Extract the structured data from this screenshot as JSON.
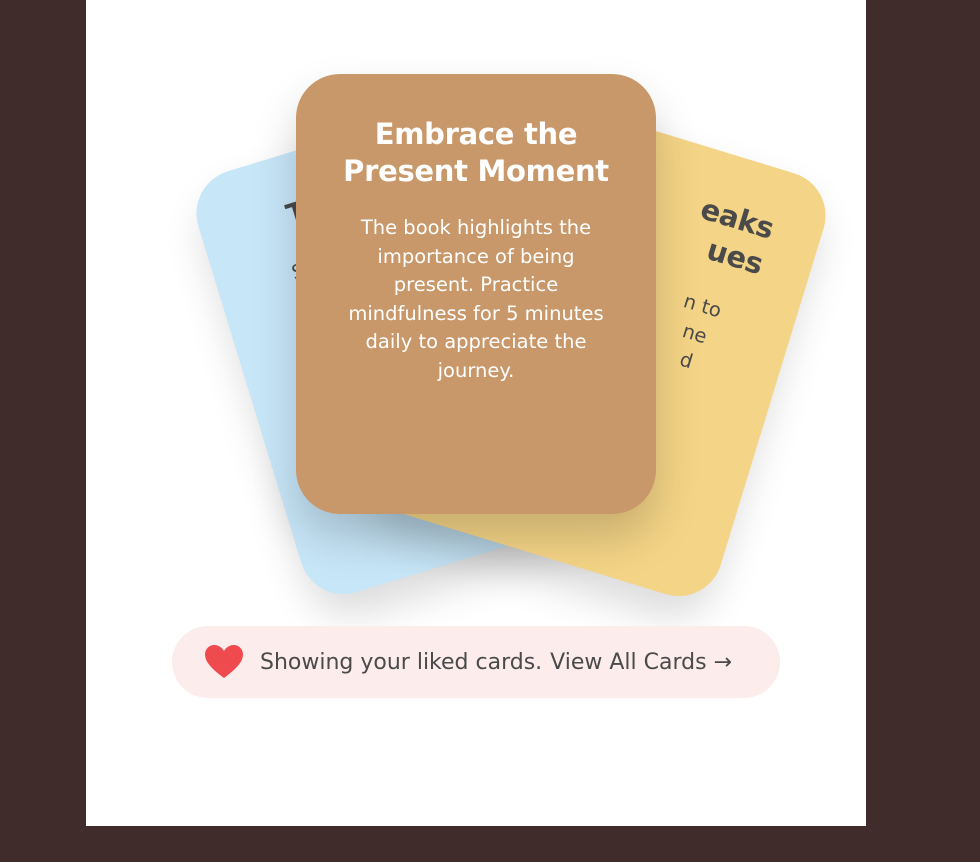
{
  "cards": [
    {
      "position": "left",
      "title": "Tr",
      "body": "Sant\nh\nm",
      "color": "#c7e6f8"
    },
    {
      "position": "right",
      "title": "eaks\nues",
      "body": "n to\nne\nd",
      "color": "#f4d486"
    },
    {
      "position": "front",
      "title": "Embrace the Present Moment",
      "body": "The book highlights the importance of being present. Practice mindfulness for 5 minutes daily to appreciate the journey.",
      "color": "#c8986a"
    }
  ],
  "banner": {
    "icon": "heart-icon",
    "icon_color": "#ef4b4f",
    "text": "Showing your liked cards.",
    "link_label": "View All Cards →",
    "background": "#fdecec"
  },
  "colors": {
    "backdrop": "#3f2c2b",
    "panel": "#ffffff"
  }
}
